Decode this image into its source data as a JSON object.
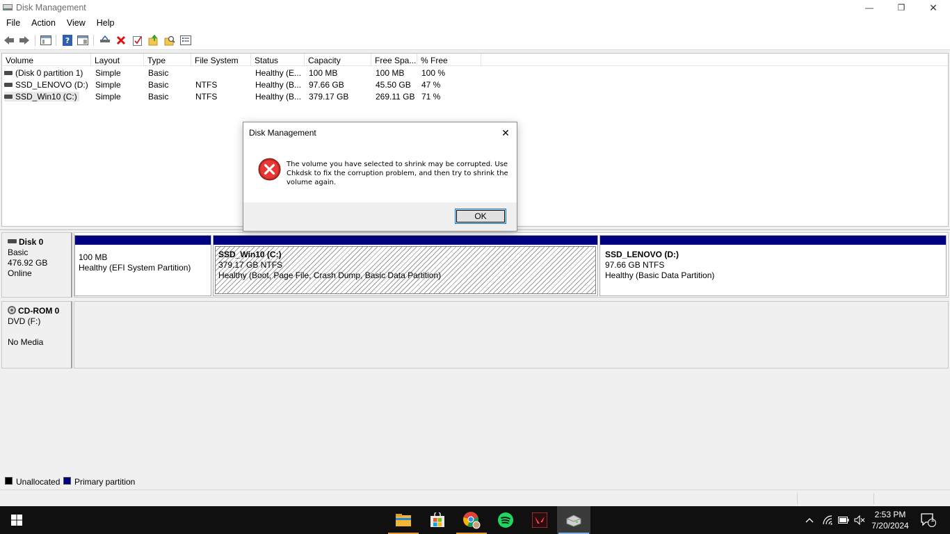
{
  "window": {
    "title": "Disk Management",
    "minimize_glyph": "—",
    "maximize_glyph": "❐",
    "close_glyph": "✕"
  },
  "menu": [
    "File",
    "Action",
    "View",
    "Help"
  ],
  "toolbar": {
    "icons": [
      "back-icon",
      "forward-icon",
      "console-tree-icon",
      "help-icon",
      "properties-icon",
      "connect-icon",
      "delete-icon",
      "check-icon",
      "open-icon",
      "explore-icon",
      "list-view-icon"
    ]
  },
  "volume_list": {
    "columns": [
      "Volume",
      "Layout",
      "Type",
      "File System",
      "Status",
      "Capacity",
      "Free Spa...",
      "% Free"
    ],
    "rows": [
      {
        "volume": "(Disk 0 partition 1)",
        "layout": "Simple",
        "type": "Basic",
        "fs": "",
        "status": "Healthy (E...",
        "capacity": "100 MB",
        "free": "100 MB",
        "pct": "100 %"
      },
      {
        "volume": "SSD_LENOVO (D:)",
        "layout": "Simple",
        "type": "Basic",
        "fs": "NTFS",
        "status": "Healthy (B...",
        "capacity": "97.66 GB",
        "free": "45.50 GB",
        "pct": "47 %"
      },
      {
        "volume": "SSD_Win10 (C:)",
        "layout": "Simple",
        "type": "Basic",
        "fs": "NTFS",
        "status": "Healthy (B...",
        "capacity": "379.17 GB",
        "free": "269.11 GB",
        "pct": "71 %"
      }
    ]
  },
  "disks": [
    {
      "name": "Disk 0",
      "kind": "Basic",
      "size": "476.92 GB",
      "state": "Online",
      "partitions": [
        {
          "name": "",
          "size": "100 MB",
          "status": "Healthy (EFI System Partition)"
        },
        {
          "name": "SSD_Win10  (C:)",
          "size": "379.17 GB NTFS",
          "status": "Healthy (Boot, Page File, Crash Dump, Basic Data Partition)"
        },
        {
          "name": "SSD_LENOVO  (D:)",
          "size": "97.66 GB NTFS",
          "status": "Healthy (Basic Data Partition)"
        }
      ]
    },
    {
      "name": "CD-ROM 0",
      "kind": "DVD (F:)",
      "size": "",
      "state": "No Media"
    }
  ],
  "legend": [
    {
      "label": "Unallocated",
      "color": "#000000"
    },
    {
      "label": "Primary partition",
      "color": "#000080"
    }
  ],
  "dialog": {
    "title": "Disk Management",
    "message": "The volume you have selected to shrink may be corrupted. Use Chkdsk to fix the corruption problem, and then try to shrink the volume again.",
    "ok_label": "OK",
    "close_glyph": "✕",
    "icon": "error-icon"
  },
  "taskbar": {
    "apps": [
      "file-explorer-icon",
      "microsoft-store-icon",
      "chrome-icon",
      "spotify-icon",
      "valorant-icon",
      "disk-management-icon"
    ],
    "time": "2:53 PM",
    "date": "7/20/2024",
    "notification_count": "1"
  },
  "colors": {
    "primary_partition": "#000080",
    "accent": "#0078d7",
    "error": "#d32f2f"
  }
}
